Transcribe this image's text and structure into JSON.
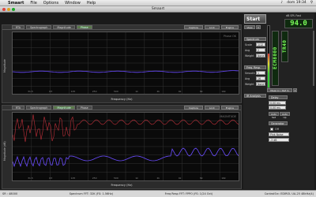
{
  "menubar": {
    "app": "Smaart",
    "items": [
      "File",
      "Options",
      "Window",
      "Help"
    ],
    "clock": "dom 19:34"
  },
  "window": {
    "title": "Smaart"
  },
  "spectrum_panel": {
    "tabs": [
      "RTA",
      "Spectrograph",
      "Magnitude",
      "Phase"
    ],
    "active_tab": 0,
    "buttons": [
      "Capture",
      "Lock",
      "Engine"
    ],
    "xlabel": "Frequency (Hz)",
    "ylabel": "Magnitude",
    "watermark": "Phase OK",
    "trace_color": "#6a4cff"
  },
  "transfer_panel": {
    "tabs": [
      "RTA",
      "Spectrograph",
      "Magnitude",
      "Phase"
    ],
    "active_tab": 2,
    "buttons": [
      "Capture",
      "Lock",
      "Engine"
    ],
    "xlabel": "Frequency (Hz)",
    "ylabel": "Magnitude (dB)",
    "watermark": "MAGNITUDE",
    "trace_color": "#6a4cff",
    "coherence_color": "#c0303a"
  },
  "sidebar": {
    "start_label": "Start",
    "spectrum_group": "Spectrum",
    "scale_label": "Scale",
    "scale_value": "1/12",
    "avg_label": "Avg",
    "avg_value": "2",
    "weight_label": "Weight",
    "weight_value": "None",
    "freq_resp_group": "Freq. Resp.",
    "smooth_label": "Smooth",
    "smooth_value": "1",
    "avg2_label": "Avg",
    "avg2_value": "16",
    "weight2_label": "Weight",
    "weight2_value": "None",
    "ir_group": "IR Analysis",
    "mean_label": "Mean In / Ref In",
    "delay_group": "Delay",
    "delay_value": "0.00 ms",
    "delay_value2": "0.00 ms",
    "autoset_label": "Auto Set",
    "autoup_label": "Auto Up",
    "generator_group": "Generator",
    "generator_on": "Off",
    "noise_label": "Pink Noise",
    "noise_level": "-3 dB",
    "spl_label": "dB SPL Fast",
    "spl_value": "94.0",
    "mic_label": "ECM8000",
    "mic_label2": "TR40",
    "meter_left_level": 0.55,
    "meter_right_level": 0.7
  },
  "statusbar": {
    "left": "SR : 48000",
    "center": "Spectrum FFT: 32K (FS: 1.56Hz)",
    "center2": "Freq Resp FFT: FPPO (FS: 1/24 Oct)",
    "right": "ControlSrc: EDIROL UA-25 48kHz(4)"
  },
  "ticks": {
    "x": [
      "31.5",
      "63",
      "125",
      "250",
      "500",
      "1k",
      "2k",
      "4k",
      "8k",
      "16k"
    ]
  }
}
